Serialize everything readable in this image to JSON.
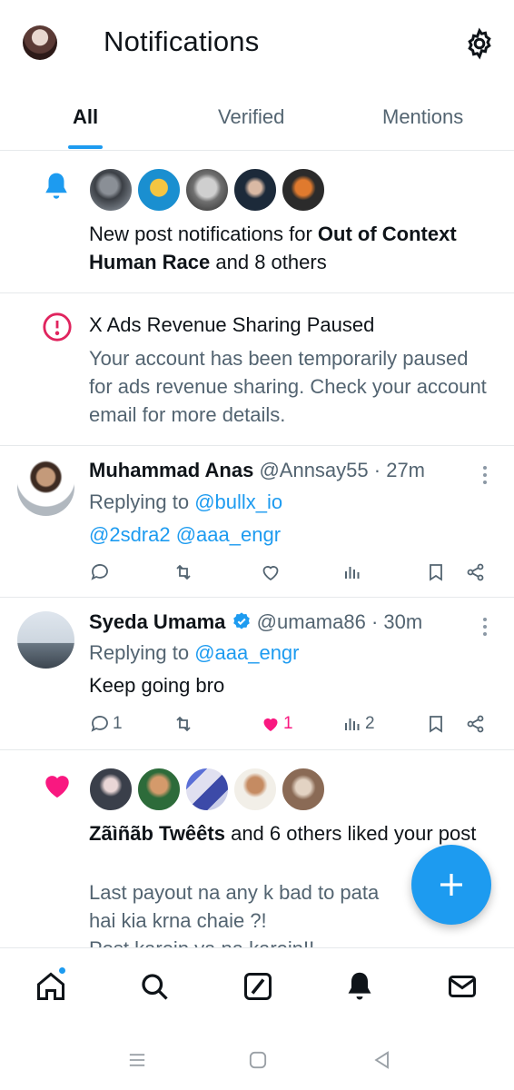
{
  "header": {
    "title": "Notifications"
  },
  "tabs": [
    {
      "label": "All"
    },
    {
      "label": "Verified"
    },
    {
      "label": "Mentions"
    }
  ],
  "notifications": {
    "post_notifications": {
      "text_prefix": "New post notifications for ",
      "bold_name": "Out of Context Human Race",
      "text_suffix": " and 8 others"
    },
    "ads_paused": {
      "title": "X Ads Revenue Sharing Paused",
      "body": "Your account has been temporarily paused for ads revenue sharing. Check your account email for more details."
    },
    "reply1": {
      "name": "Muhammad Anas",
      "handle": "@Annsay55",
      "time": "· 27m",
      "replying_label": "Replying to ",
      "replying_to": "@bullx_io",
      "body_mentions": "@2sdra2 @aaa_engr"
    },
    "reply2": {
      "name": "Syeda Umama",
      "handle": "@umama86",
      "time": "· 30m",
      "replying_label": "Replying to ",
      "replying_to": "@aaa_engr",
      "body": "Keep going bro",
      "replies": "1",
      "likes": "1",
      "views": "2"
    },
    "likes": {
      "bold_name": "Zãìñãb Twêêts",
      "text_suffix": " and 6 others liked your post",
      "post_line1": "Last payout na any k bad to pata",
      "post_line2": "hai kia krna chaie ?!",
      "post_line3": "Post karein ya na karein!!"
    }
  },
  "colors": {
    "accent": "#1d9bf0",
    "like": "#f91880",
    "alert": "#e0245e",
    "muted": "#536471"
  }
}
